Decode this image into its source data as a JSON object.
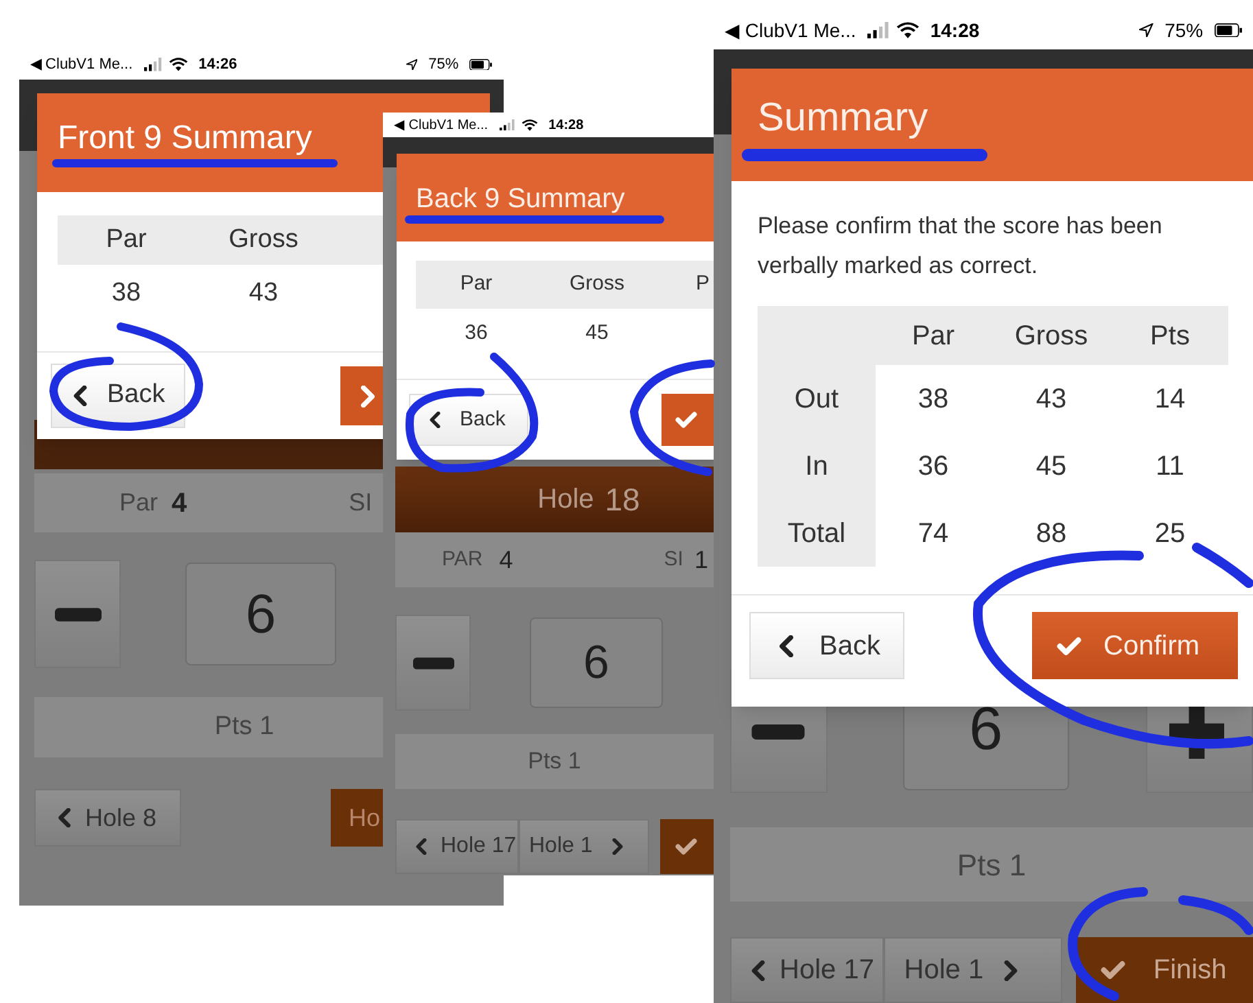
{
  "screens": [
    {
      "status_bar": {
        "back_label": "◀ ClubV1 Me...",
        "time": "14:26",
        "battery": "75%"
      },
      "dialog": {
        "title": "Front 9 Summary",
        "columns": [
          "Par",
          "Gross"
        ],
        "values": [
          "38",
          "43"
        ],
        "back_button": "Back"
      },
      "hole_info": {
        "par_label": "Par",
        "par": "4",
        "si_label": "SI"
      },
      "score": "6",
      "points": "Pts 1",
      "nav": {
        "previous": "Hole 8",
        "next": "Ho"
      }
    },
    {
      "status_bar": {
        "back_label": "◀ ClubV1 Me...",
        "time": "14:28"
      },
      "dialog": {
        "title": "Back 9 Summary",
        "columns": [
          "Par",
          "Gross",
          "P"
        ],
        "values": [
          "36",
          "45"
        ],
        "back_button": "Back"
      },
      "hole_bar": {
        "label": "Hole",
        "number": "18"
      },
      "hole_info": {
        "par_label": "PAR",
        "par": "4",
        "si_label": "SI",
        "si": "1"
      },
      "score": "6",
      "points": "Pts 1",
      "nav": {
        "previous": "Hole 17",
        "next": "Hole 1"
      }
    },
    {
      "status_bar": {
        "back_label": "◀ ClubV1 Me...",
        "time": "14:28",
        "battery": "75%"
      },
      "dialog": {
        "title": "Summary",
        "message": "Please confirm that the score has been verbally marked as correct.",
        "columns": [
          "Par",
          "Gross",
          "Pts"
        ],
        "rows": [
          {
            "label": "Out",
            "values": [
              "38",
              "43",
              "14"
            ]
          },
          {
            "label": "In",
            "values": [
              "36",
              "45",
              "11"
            ]
          },
          {
            "label": "Total",
            "values": [
              "74",
              "88",
              "25"
            ]
          }
        ],
        "back_button": "Back",
        "confirm_button": "Confirm"
      },
      "score": "6",
      "points": "Pts 1",
      "nav": {
        "previous": "Hole 17",
        "next": "Hole 1",
        "finish": "Finish"
      }
    }
  ]
}
